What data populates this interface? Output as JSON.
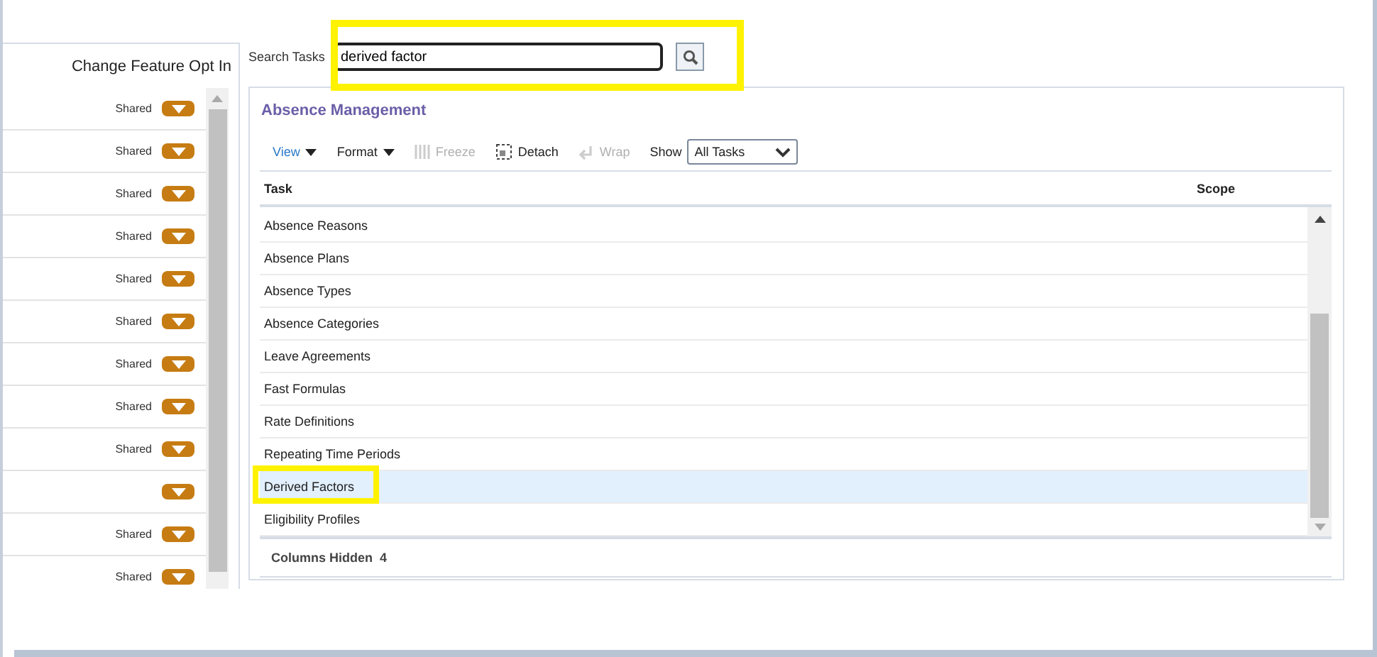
{
  "left_panel": {
    "header": "Change Feature Opt In",
    "rows": [
      {
        "label": "Shared"
      },
      {
        "label": "Shared"
      },
      {
        "label": "Shared"
      },
      {
        "label": "Shared"
      },
      {
        "label": "Shared"
      },
      {
        "label": "Shared"
      },
      {
        "label": "Shared"
      },
      {
        "label": "Shared"
      },
      {
        "label": "Shared"
      },
      {},
      {
        "label": "Shared"
      },
      {
        "label": "Shared"
      }
    ]
  },
  "search": {
    "label": "Search Tasks",
    "value": "derived factor"
  },
  "panel": {
    "title": "Absence Management",
    "toolbar": [
      {
        "kind": "menu",
        "label": "View",
        "disabled": false,
        "link": true
      },
      {
        "kind": "menu",
        "label": "Format",
        "disabled": false,
        "link": false
      },
      {
        "kind": "freeze",
        "label": "Freeze",
        "disabled": true
      },
      {
        "kind": "detach",
        "label": "Detach",
        "disabled": false
      },
      {
        "kind": "wrap",
        "label": "Wrap",
        "disabled": true
      }
    ],
    "show": {
      "label": "Show",
      "value": "All Tasks"
    },
    "columns": [
      "Task",
      "Scope"
    ],
    "rows": [
      {
        "task": "Absence Reasons",
        "selected": false
      },
      {
        "task": "Absence Plans",
        "selected": false
      },
      {
        "task": "Absence Types",
        "selected": false
      },
      {
        "task": "Absence Categories",
        "selected": false
      },
      {
        "task": "Leave Agreements",
        "selected": false
      },
      {
        "task": "Fast Formulas",
        "selected": false
      },
      {
        "task": "Rate Definitions",
        "selected": false
      },
      {
        "task": "Repeating Time Periods",
        "selected": false
      },
      {
        "task": "Derived Factors",
        "selected": true
      },
      {
        "task": "Eligibility Profiles",
        "selected": false
      }
    ],
    "footer": {
      "label": "Columns Hidden",
      "count": "4"
    }
  }
}
